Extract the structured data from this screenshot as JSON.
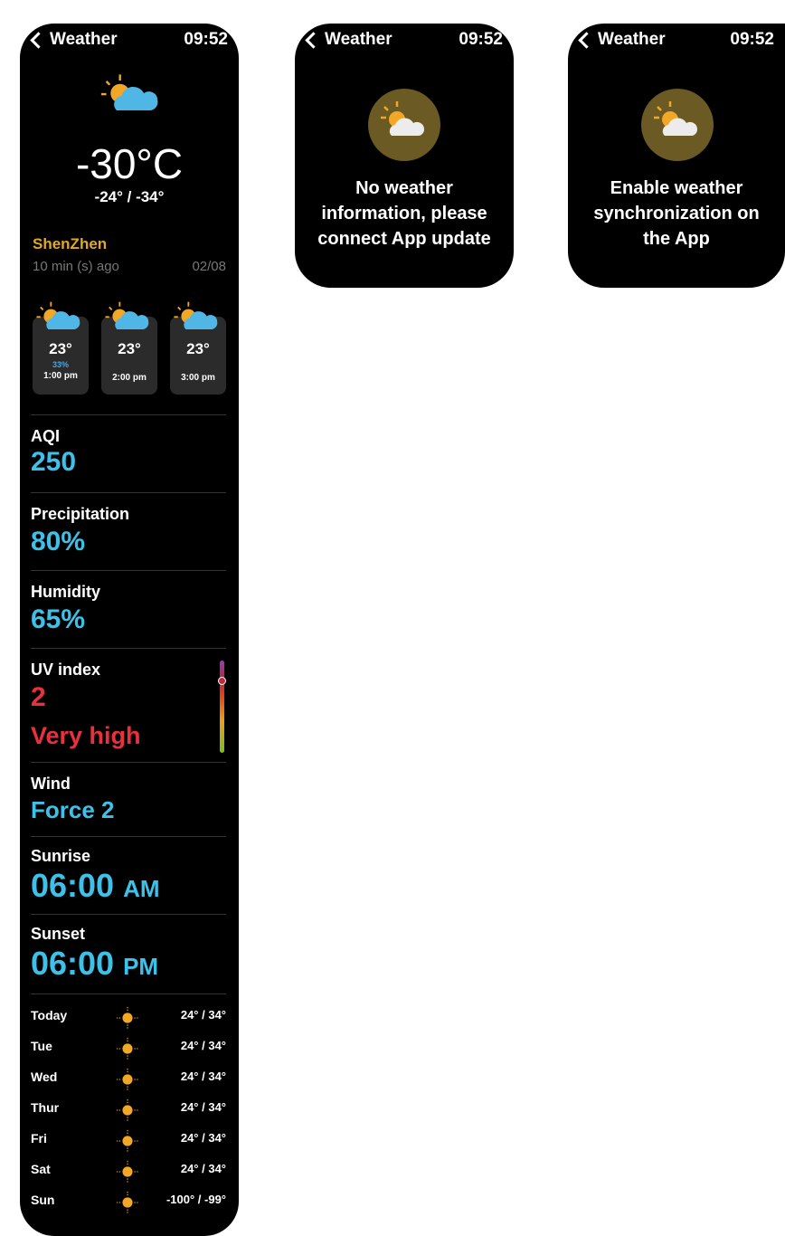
{
  "main": {
    "header": {
      "title": "Weather",
      "time": "09:52"
    },
    "current": {
      "temp": "-30°C",
      "range": "-24° / -34°"
    },
    "location": {
      "city": "ShenZhen",
      "updated": "10 min (s) ago",
      "date": "02/08"
    },
    "hourly": [
      {
        "temp": "23°",
        "precip": "33%",
        "time": "1:00 pm"
      },
      {
        "temp": "23°",
        "time": "2:00 pm"
      },
      {
        "temp": "23°",
        "time": "3:00 pm"
      }
    ],
    "aqi": {
      "label": "AQI",
      "value": "250"
    },
    "precipitation": {
      "label": "Precipitation",
      "value": "80%"
    },
    "humidity": {
      "label": "Humidity",
      "value": "65%"
    },
    "uv": {
      "label": "UV index",
      "value": "2",
      "level": "Very high"
    },
    "wind": {
      "label": "Wind",
      "value": "Force 2"
    },
    "sunrise": {
      "label": "Sunrise",
      "time": "06:00",
      "ampm": "AM"
    },
    "sunset": {
      "label": "Sunset",
      "time": "06:00",
      "ampm": "PM"
    },
    "daily": [
      {
        "day": "Today",
        "range": "24° / 34°",
        "icon": "sun-icon"
      },
      {
        "day": "Tue",
        "range": "24° / 34°",
        "icon": "sun-icon"
      },
      {
        "day": "Wed",
        "range": "24° / 34°",
        "icon": "sun-icon"
      },
      {
        "day": "Thur",
        "range": "24° / 34°",
        "icon": "sun-icon"
      },
      {
        "day": "Fri",
        "range": "24° / 34°",
        "icon": "sun-icon"
      },
      {
        "day": "Sat",
        "range": "24° / 34°",
        "icon": "sun-icon"
      },
      {
        "day": "Sun",
        "range": "-100° / -99°",
        "icon": "sun-icon"
      }
    ]
  },
  "no_data": {
    "header": {
      "title": "Weather",
      "time": "09:52"
    },
    "line1": "No weather",
    "line2": "information, please",
    "line3": "connect App update"
  },
  "enable_sync": {
    "header": {
      "title": "Weather",
      "time": "09:52"
    },
    "line1": "Enable weather",
    "line2": "synchronization on",
    "line3": "the App"
  },
  "colors": {
    "accent_blue": "#3ec1e8",
    "city_gold": "#e0a826",
    "alert_red": "#e8303f",
    "cloud_blue": "#4fb6e6",
    "sun_orange": "#f2a826"
  }
}
